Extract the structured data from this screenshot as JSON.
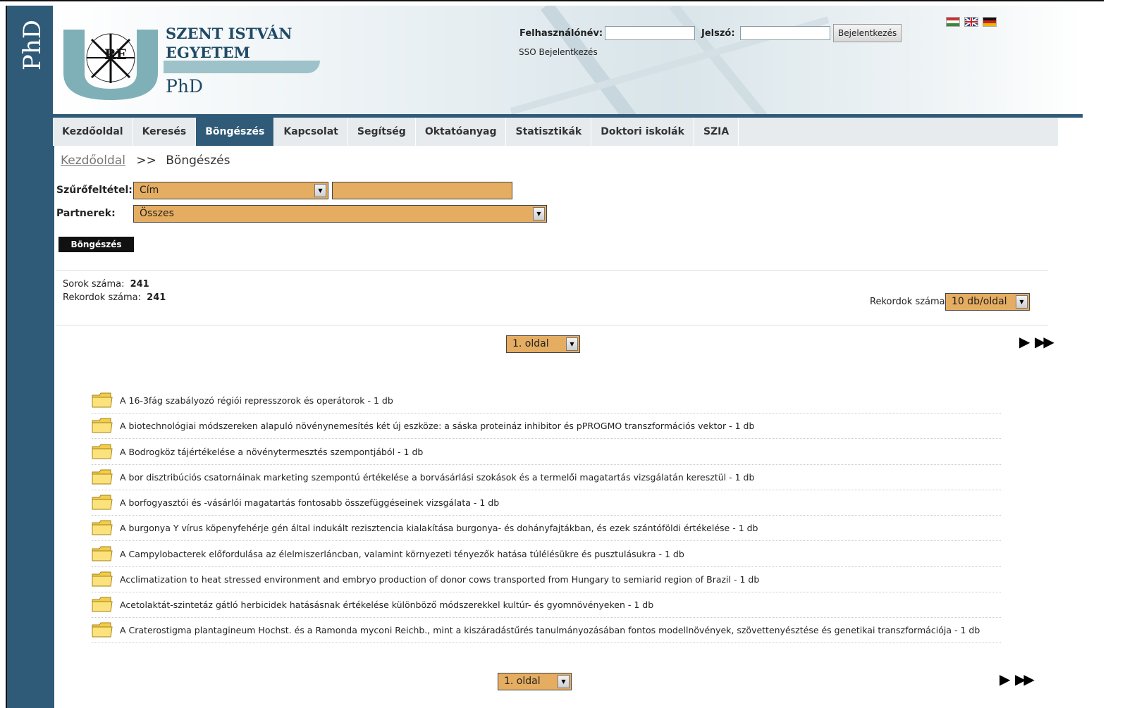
{
  "brand": {
    "side_label": "PhD",
    "line1": "SZENT ISTVÁN",
    "line2": "EGYETEM",
    "line3": "PhD",
    "seal_letters": "RE"
  },
  "login": {
    "username_label": "Felhasználónév:",
    "password_label": "Jelszó:",
    "button": "Bejelentkezés",
    "sso": "SSO Bejelentkezés"
  },
  "flags": [
    "hungarian-flag",
    "english-flag",
    "german-flag"
  ],
  "nav": {
    "tabs": [
      {
        "label": "Kezdőoldal"
      },
      {
        "label": "Keresés"
      },
      {
        "label": "Böngészés",
        "active": true
      },
      {
        "label": "Kapcsolat"
      },
      {
        "label": "Segítség"
      },
      {
        "label": "Oktatóanyag"
      },
      {
        "label": "Statisztikák"
      },
      {
        "label": "Doktori iskolák"
      },
      {
        "label": "SZIA"
      }
    ]
  },
  "breadcrumb": {
    "home": "Kezdőoldal",
    "sep": ">>",
    "current": "Böngészés"
  },
  "filter": {
    "label": "Szűrőfeltétel:",
    "field_value": "Cím",
    "partners_label": "Partnerek:",
    "partners_value": "Összes",
    "button": "Böngészés"
  },
  "stats": {
    "rows_label": "Sorok száma:",
    "rows_value": "241",
    "records_label": "Rekordok száma:",
    "records_value": "241",
    "per_page_label": "Rekordok száma:",
    "per_page_value": "10 db/oldal"
  },
  "pagination": {
    "page_value": "1. oldal"
  },
  "colors": {
    "accent": "#2f5a78",
    "select_bg": "#e5ad61"
  },
  "results": [
    "A 16-3fág szabályozó régiói represszorok és operátorok - 1 db",
    "A biotechnológiai módszereken alapuló növénynemesítés két új eszköze: a sáska proteináz inhibitor és pPROGMO transzformációs vektor - 1 db",
    "A Bodrogköz tájértékelése a növénytermesztés szempontjából - 1 db",
    "A bor disztribúciós csatornáinak marketing szempontú értékelése a borvásárlási szokások és a termelői magatartás vizsgálatán keresztül - 1 db",
    "A borfogyasztói és -vásárlói magatartás fontosabb összefüggéseinek vizsgálata - 1 db",
    "A burgonya Y vírus köpenyfehérje gén által indukált rezisztencia kialakítása burgonya- és dohányfajtákban, és ezek szántóföldi értékelése - 1 db",
    "A Campylobacterek előfordulása az élelmiszerláncban, valamint környezeti tényezők hatása túlélésükre és pusztulásukra - 1 db",
    "Acclimatization to heat stressed environment and embryo production of donor cows transported from Hungary to semiarid region of Brazil - 1 db",
    "Acetolaktát-szintetáz gátló herbicidek hatásásnak értékelése különböző módszerekkel kultúr- és gyomnövényeken - 1 db",
    "A Craterostigma plantagineum Hochst. és a Ramonda myconi Reichb., mint a kiszáradástűrés tanulmányozásában fontos modellnövények, szövettenyésztése és genetikai transzformációja - 1 db"
  ]
}
